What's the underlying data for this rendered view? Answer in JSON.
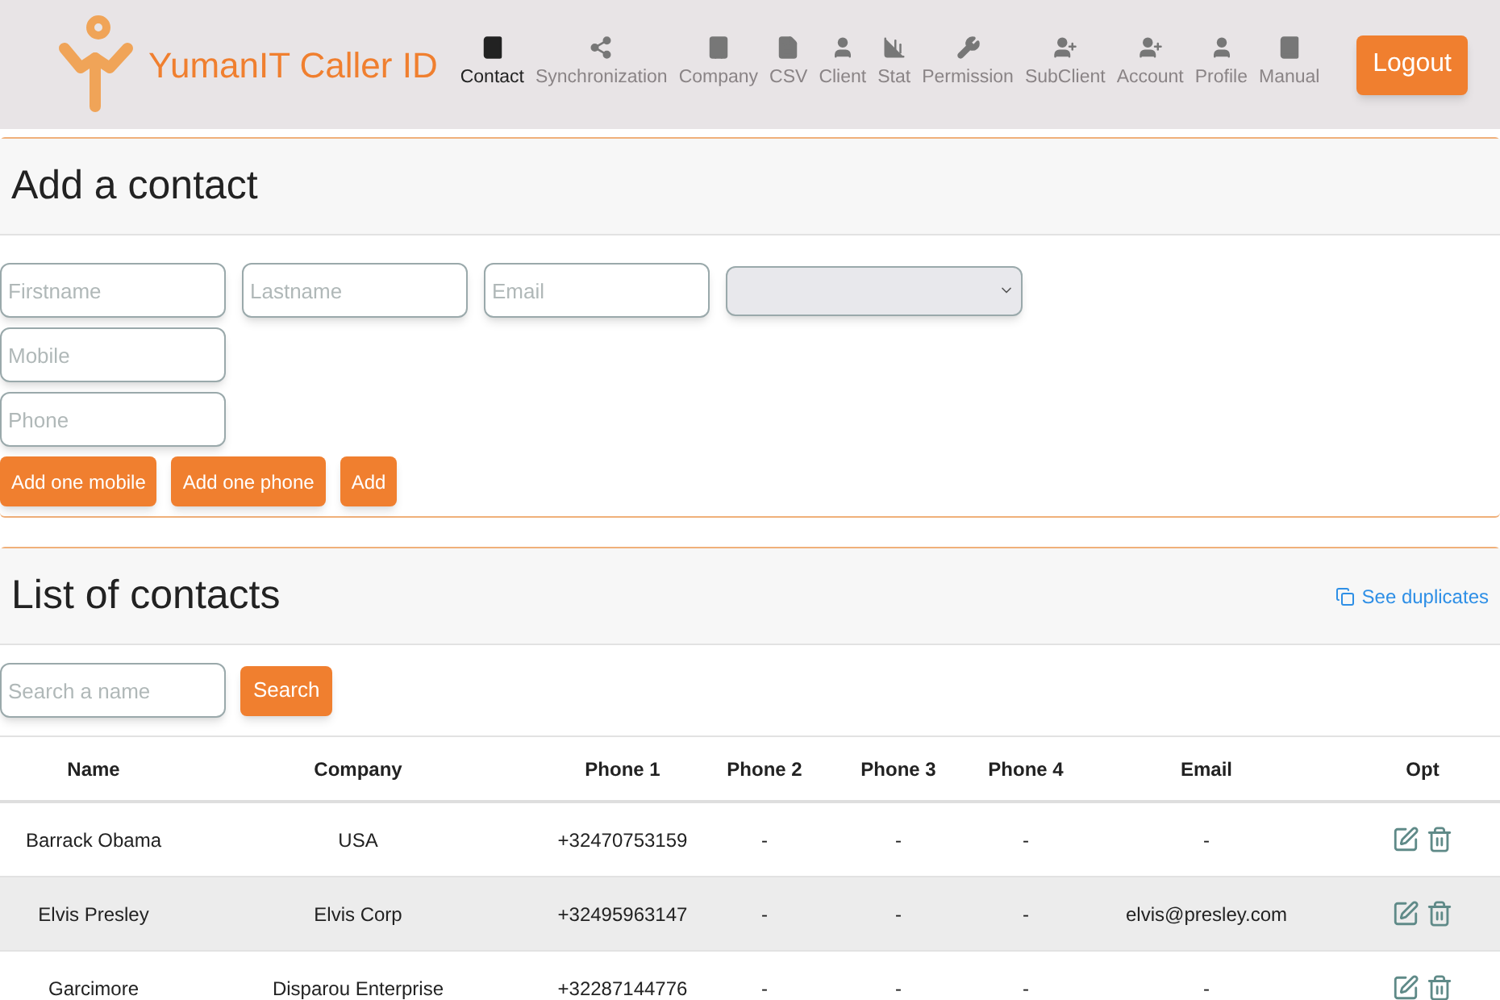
{
  "brand": {
    "name": "YumanIT Caller ID"
  },
  "nav": [
    {
      "label": "Contact",
      "selected": true
    },
    {
      "label": "Synchronization",
      "selected": false
    },
    {
      "label": "Company",
      "selected": false
    },
    {
      "label": "CSV",
      "selected": false
    },
    {
      "label": "Client",
      "selected": false
    },
    {
      "label": "Stat",
      "selected": false
    },
    {
      "label": "Permission",
      "selected": false
    },
    {
      "label": "SubClient",
      "selected": false
    },
    {
      "label": "Account",
      "selected": false
    },
    {
      "label": "Profile",
      "selected": false
    },
    {
      "label": "Manual",
      "selected": false
    }
  ],
  "logout": "Logout",
  "add_contact": {
    "title": "Add a contact",
    "fields": [
      {
        "placeholder": "Firstname"
      },
      {
        "placeholder": "Lastname"
      },
      {
        "placeholder": "Email"
      }
    ],
    "mobile": {
      "placeholder": "Mobile"
    },
    "phone": {
      "placeholder": "Phone"
    },
    "buttons": [
      "Add one mobile",
      "Add one phone",
      "Add"
    ]
  },
  "contacts": {
    "title": "List of contacts",
    "duplicates_link": "See duplicates",
    "search": {
      "placeholder": "Search a name",
      "button": "Search"
    },
    "columns": [
      "Name",
      "Company",
      "Phone 1",
      "Phone 2",
      "Phone 3",
      "Phone 4",
      "Email",
      "Opt"
    ],
    "rows": [
      [
        "Barrack Obama",
        "USA",
        "+32470753159",
        "-",
        "-",
        "-",
        "-"
      ],
      [
        "Elvis Presley",
        "Elvis Corp",
        "+32495963147",
        "-",
        "-",
        "-",
        "elvis@presley.com"
      ],
      [
        "Garcimore",
        "Disparou Enterprise",
        "+32287144776",
        "-",
        "-",
        "-",
        "-"
      ]
    ]
  }
}
